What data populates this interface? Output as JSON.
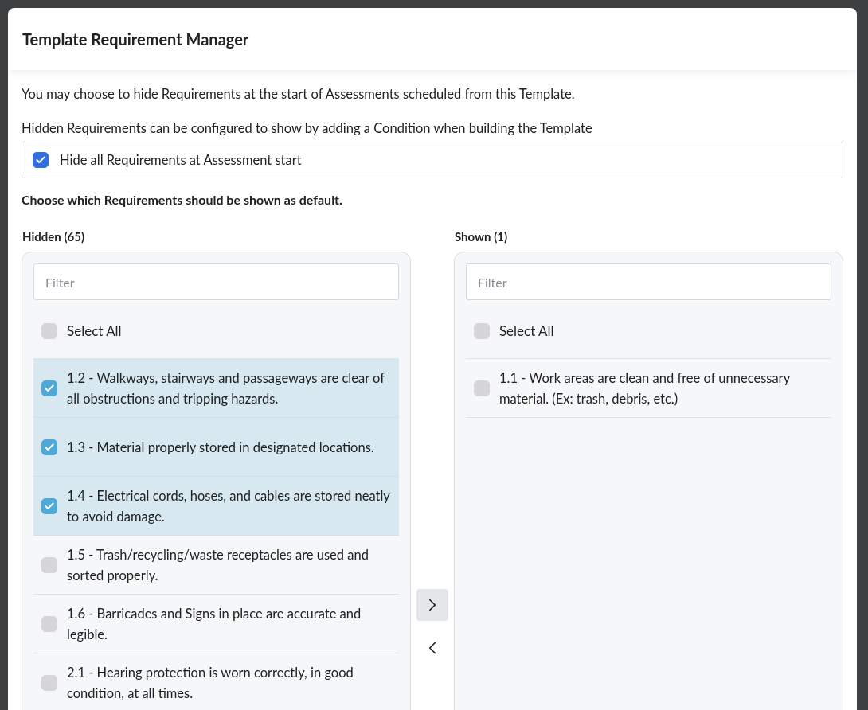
{
  "modal": {
    "title": "Template Requirement Manager"
  },
  "intro": [
    "You may choose to hide Requirements at the start of Assessments scheduled from this Template.",
    "Hidden Requirements can be configured to show by adding a Condition when building the Template"
  ],
  "hide_all": {
    "label": "Hide all Requirements at Assessment start",
    "checked": true
  },
  "instruction": "Choose which Requirements should be shown as default.",
  "lists": [
    {
      "heading": "Hidden (65)",
      "filter": {
        "placeholder": "Filter"
      },
      "select_all": {
        "label": "Select All",
        "checked": false
      },
      "items": [
        {
          "label": "1.2 - Walkways, stairways and passageways are clear of all obstructions and tripping hazards.",
          "checked": true
        },
        {
          "label": "1.3 - Material properly stored in designated locations.",
          "checked": true
        },
        {
          "label": "1.4 - Electrical cords, hoses, and cables are stored neatly to avoid damage.",
          "checked": true
        },
        {
          "label": "1.5 - Trash/recycling/waste receptacles are used and sorted properly.",
          "checked": false
        },
        {
          "label": "1.6 - Barricades and Signs in place are accurate and legible.",
          "checked": false
        },
        {
          "label": "2.1 - Hearing protection is worn correctly, in good condition, at all times.",
          "checked": false
        }
      ]
    },
    {
      "heading": "Shown (1)",
      "filter": {
        "placeholder": "Filter"
      },
      "select_all": {
        "label": "Select All",
        "checked": false
      },
      "items": [
        {
          "label": "1.1 - Work areas are clean and free of unnecessary material. (Ex: trash, debris, etc.)",
          "checked": false
        }
      ]
    }
  ],
  "move_buttons": [
    {
      "kind": "right",
      "highlighted": true
    },
    {
      "kind": "left",
      "highlighted": false
    }
  ]
}
